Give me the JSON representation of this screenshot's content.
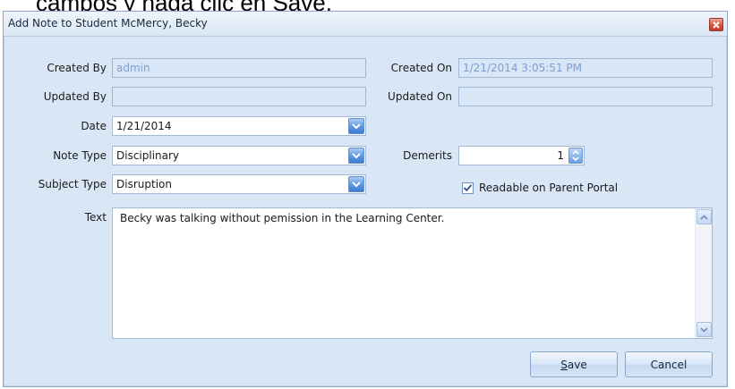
{
  "background": {
    "text": "campos y haga clic en Save."
  },
  "dialog": {
    "title": "Add Note to Student McMercy, Becky",
    "close_icon": "close-icon"
  },
  "fields": {
    "created_by": {
      "label": "Created By",
      "value": "admin"
    },
    "created_on": {
      "label": "Created On",
      "value": "1/21/2014 3:05:51 PM"
    },
    "updated_by": {
      "label": "Updated By",
      "value": ""
    },
    "updated_on": {
      "label": "Updated On",
      "value": ""
    },
    "date": {
      "label": "Date",
      "value": "1/21/2014"
    },
    "note_type": {
      "label": "Note Type",
      "value": "Disciplinary"
    },
    "demerits": {
      "label": "Demerits",
      "value": "1"
    },
    "subject_type": {
      "label": "Subject Type",
      "value": "Disruption"
    },
    "readable": {
      "label": "Readable on Parent Portal",
      "checked": true
    },
    "text": {
      "label": "Text",
      "value": "Becky was talking without pemission in the Learning Center."
    }
  },
  "buttons": {
    "save_mnemonic": "S",
    "save_rest": "ave",
    "cancel": "Cancel"
  },
  "colors": {
    "dialog_bg": "#d9e6f5",
    "readonly_text": "#7b9fd1",
    "dropdown_blue": "#5c96df",
    "close_red": "#d8523d"
  }
}
